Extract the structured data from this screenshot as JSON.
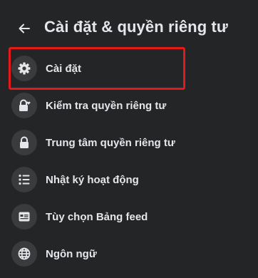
{
  "header": {
    "back_icon": "arrow-left-icon",
    "title": "Cài đặt & quyền riêng tư"
  },
  "menu": {
    "items": [
      {
        "label": "Cài đặt",
        "icon": "gear-icon"
      },
      {
        "label": "Kiểm tra quyền riêng tư",
        "icon": "lock-heart-icon"
      },
      {
        "label": "Trung tâm quyền riêng tư",
        "icon": "lock-icon"
      },
      {
        "label": "Nhật ký hoạt động",
        "icon": "list-icon"
      },
      {
        "label": "Tùy chọn Bảng feed",
        "icon": "feed-icon"
      },
      {
        "label": "Ngôn ngữ",
        "icon": "globe-icon"
      }
    ]
  },
  "colors": {
    "background": "#242526",
    "icon_circle": "#3a3b3c",
    "text": "#e4e6eb",
    "highlight": "#e41a1a"
  }
}
